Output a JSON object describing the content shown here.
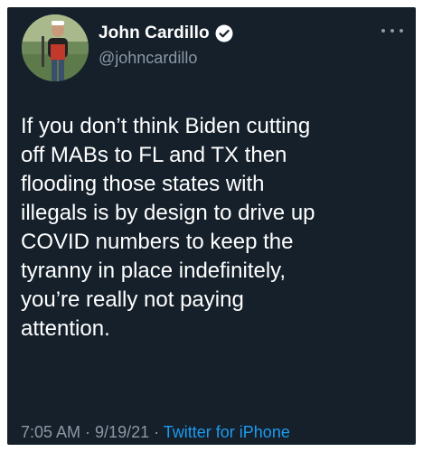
{
  "tweet": {
    "author": {
      "display_name": "John Cardillo",
      "handle": "@johncardillo",
      "verified": true,
      "verified_icon": "verified-badge-icon",
      "avatar": "avatar"
    },
    "more_icon": "more-icon",
    "text": "If you don’t think Biden cutting\noff MABs to FL and TX then\nflooding those states with\nillegals is by design to drive up\nCOVID numbers to keep the\ntyranny in place indefinitely,\nyou’re really not paying\nattention.",
    "time": "7:05 AM",
    "date": "9/19/21",
    "separator": " · ",
    "source": "Twitter for iPhone"
  },
  "colors": {
    "background": "#15202b",
    "text": "#ffffff",
    "secondary": "#8b98a5",
    "accent": "#1d9bf0"
  }
}
